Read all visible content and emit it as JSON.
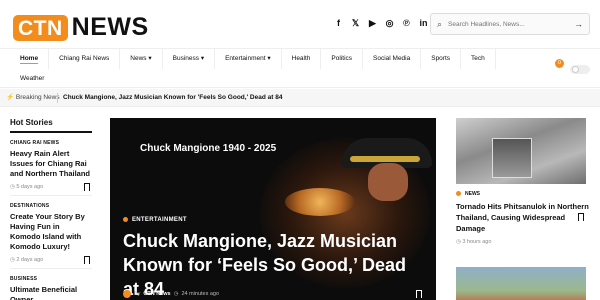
{
  "brand": {
    "logo_box": "CTN",
    "logo_text": "NEWS",
    "accent": "#f28c1d"
  },
  "socials": [
    "facebook-icon",
    "x-icon",
    "youtube-icon",
    "instagram-icon",
    "pinterest-icon",
    "linkedin-icon",
    "telegram-icon"
  ],
  "search": {
    "placeholder": "Search Headlines, News..."
  },
  "nav": {
    "items": [
      "Home",
      "Chiang Rai News",
      "News",
      "Business",
      "Entertainment",
      "Health",
      "Politics",
      "Social Media",
      "Sports",
      "Tech"
    ],
    "dropdown_items": [
      "News",
      "Business",
      "Entertainment"
    ],
    "row2": "Weather",
    "badge": "0"
  },
  "breaking": {
    "label": "Breaking News",
    "headline": "Chuck Mangione, Jazz Musician Known for 'Feels So Good,' Dead at 84"
  },
  "hot_stories": {
    "heading": "Hot Stories",
    "items": [
      {
        "category": "CHIANG RAI NEWS",
        "title": "Heavy Rain Alert Issues for Chiang Rai and Northern Thailand",
        "time": "5 days ago"
      },
      {
        "category": "DESTINATIONS",
        "title": "Create Your Story By Having Fun in Komodo Island with Komodo Luxury!",
        "time": "2 days ago"
      },
      {
        "category": "BUSINESS",
        "title": "Ultimate Beneficial Owner",
        "time": ""
      }
    ]
  },
  "hero": {
    "image_caption": "Chuck Mangione 1940 - 2025",
    "category": "ENTERTAINMENT",
    "title": "Chuck Mangione, Jazz Musician Known for ‘Feels So Good,’ Dead at 84",
    "by": "By",
    "author": "CTN News",
    "time": "24 minutes ago"
  },
  "right": {
    "category": "NEWS",
    "title": "Tornado Hits Phitsanulok in Northern Thailand, Causing Widespread Damage",
    "time": "3 hours ago"
  }
}
